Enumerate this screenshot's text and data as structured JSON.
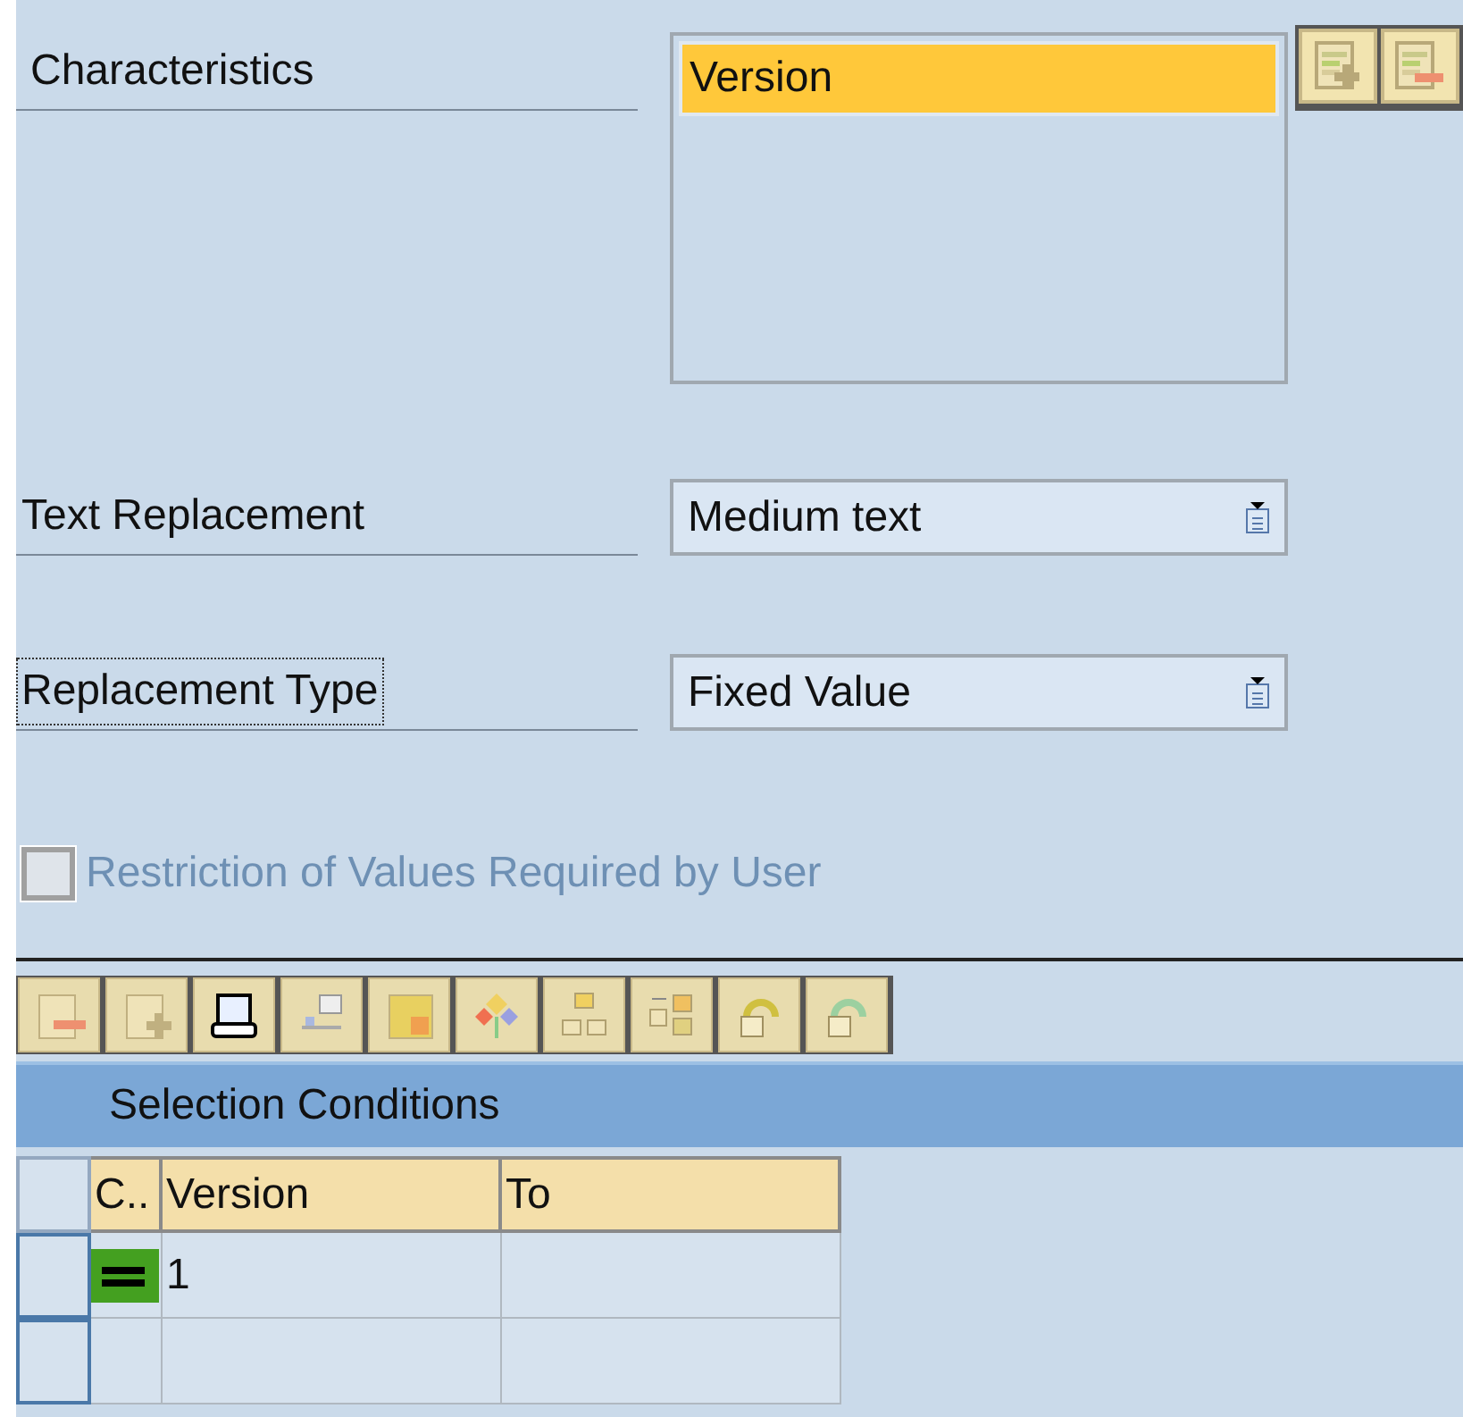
{
  "characteristics": {
    "label": "Characteristics",
    "items": [
      {
        "text": "Version",
        "selected": true
      }
    ]
  },
  "fields": [
    {
      "label": "Text Replacement",
      "value": "Medium text",
      "focused": false
    },
    {
      "label": "Replacement Type",
      "value": "Fixed Value",
      "focused": true
    }
  ],
  "restriction": {
    "label": "Restriction of Values Required by User",
    "checked": false,
    "disabled": true
  },
  "selection": {
    "title": "Selection Conditions",
    "columns": [
      "C..",
      "Version",
      "To"
    ],
    "rows": [
      {
        "option_set": true,
        "cells": [
          "",
          "1",
          ""
        ]
      },
      {
        "option_set": false,
        "cells": [
          "",
          "",
          ""
        ]
      }
    ]
  }
}
